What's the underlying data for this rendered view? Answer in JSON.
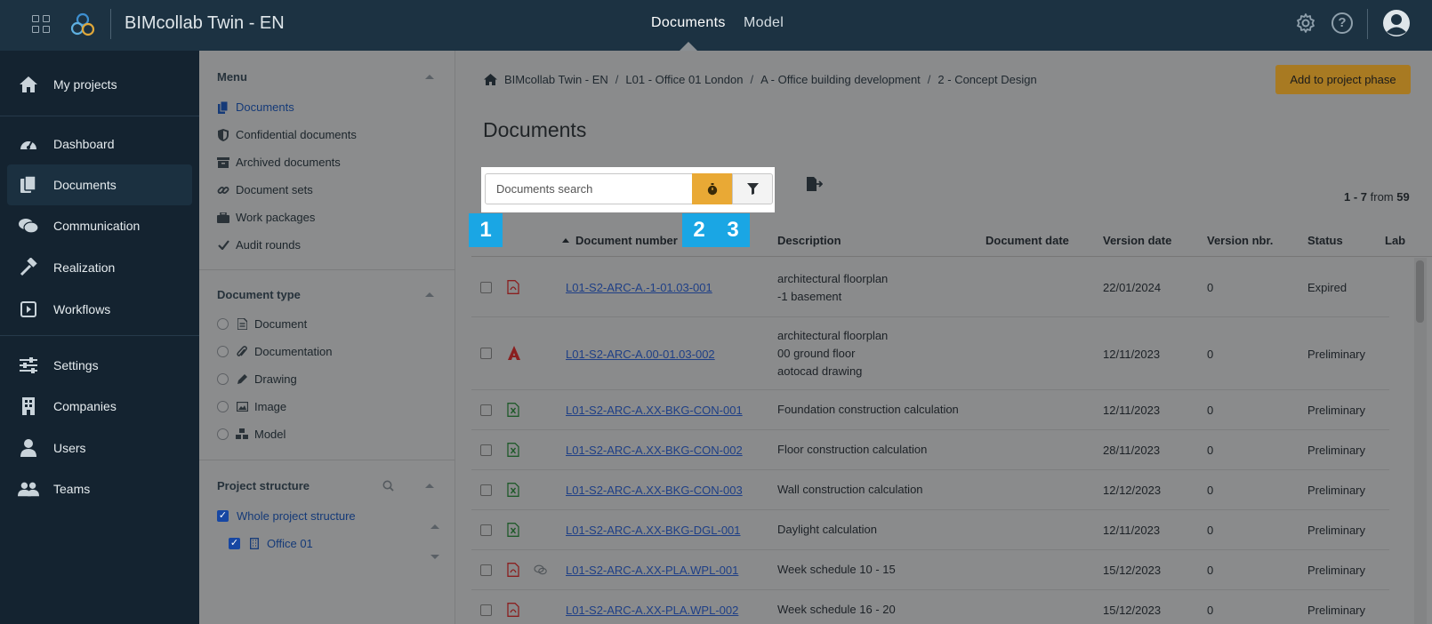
{
  "topbar": {
    "app_title": "BIMcollab Twin - EN",
    "nav_documents": "Documents",
    "nav_model": "Model"
  },
  "sidebar": {
    "items": [
      {
        "label": "My projects",
        "icon": "home-icon"
      },
      {
        "label": "Dashboard",
        "icon": "gauge-icon"
      },
      {
        "label": "Documents",
        "icon": "documents-icon",
        "active": true
      },
      {
        "label": "Communication",
        "icon": "chat-icon"
      },
      {
        "label": "Realization",
        "icon": "hammer-icon"
      },
      {
        "label": "Workflows",
        "icon": "workflow-icon"
      },
      {
        "label": "Settings",
        "icon": "sliders-icon"
      },
      {
        "label": "Companies",
        "icon": "building-icon"
      },
      {
        "label": "Users",
        "icon": "user-icon"
      },
      {
        "label": "Teams",
        "icon": "team-icon"
      }
    ]
  },
  "filters": {
    "menu_heading": "Menu",
    "menu_items": [
      {
        "label": "Documents",
        "icon": "documents-icon"
      },
      {
        "label": "Confidential documents",
        "icon": "shield-icon"
      },
      {
        "label": "Archived documents",
        "icon": "archive-icon"
      },
      {
        "label": "Document sets",
        "icon": "link-icon"
      },
      {
        "label": "Work packages",
        "icon": "briefcase-icon"
      },
      {
        "label": "Audit rounds",
        "icon": "check-icon"
      }
    ],
    "doctype_heading": "Document type",
    "doctype_items": [
      {
        "label": "Document",
        "icon": "file-icon"
      },
      {
        "label": "Documentation",
        "icon": "paperclip-icon"
      },
      {
        "label": "Drawing",
        "icon": "pencil-icon"
      },
      {
        "label": "Image",
        "icon": "image-icon"
      },
      {
        "label": "Model",
        "icon": "cubes-icon"
      }
    ],
    "structure_heading": "Project structure",
    "structure_items": [
      {
        "label": "Whole project structure",
        "checked": true
      },
      {
        "label": "Office 01",
        "checked": true,
        "icon": "building-icon"
      }
    ]
  },
  "main": {
    "breadcrumb": [
      "BIMcollab Twin - EN",
      "L01 - Office 01 London",
      "A - Office building development",
      "2 - Concept Design"
    ],
    "add_phase_label": "Add to project phase",
    "page_title": "Documents",
    "search_placeholder": "Documents search",
    "badges": [
      "1",
      "2",
      "3"
    ],
    "pager": {
      "range": "1 - 7",
      "from_label": "from",
      "total": "59"
    },
    "columns": [
      "Document number",
      "Description",
      "Document date",
      "Version date",
      "Version nbr.",
      "Status",
      "Lab"
    ],
    "rows": [
      {
        "type": "pdf",
        "number": "L01-S2-ARC-A.-1-01.03-001",
        "desc": [
          "architectural floorplan",
          "-1 basement"
        ],
        "version_date": "22/01/2024",
        "version_nbr": "0",
        "status": "Expired"
      },
      {
        "type": "autocad",
        "number": "L01-S2-ARC-A.00-01.03-002",
        "desc": [
          "architectural floorplan",
          "00 ground floor",
          "aotocad drawing"
        ],
        "version_date": "12/11/2023",
        "version_nbr": "0",
        "status": "Preliminary"
      },
      {
        "type": "excel",
        "number": "L01-S2-ARC-A.XX-BKG-CON-001",
        "desc": [
          "Foundation construction calculation"
        ],
        "version_date": "12/11/2023",
        "version_nbr": "0",
        "status": "Preliminary"
      },
      {
        "type": "excel",
        "number": "L01-S2-ARC-A.XX-BKG-CON-002",
        "desc": [
          "Floor construction calculation"
        ],
        "version_date": "28/11/2023",
        "version_nbr": "0",
        "status": "Preliminary"
      },
      {
        "type": "excel",
        "number": "L01-S2-ARC-A.XX-BKG-CON-003",
        "desc": [
          "Wall construction calculation"
        ],
        "version_date": "12/12/2023",
        "version_nbr": "0",
        "status": "Preliminary"
      },
      {
        "type": "excel",
        "number": "L01-S2-ARC-A.XX-BKG-DGL-001",
        "desc": [
          "Daylight calculation"
        ],
        "version_date": "12/11/2023",
        "version_nbr": "0",
        "status": "Preliminary"
      },
      {
        "type": "pdf",
        "comment": true,
        "number": "L01-S2-ARC-A.XX-PLA.WPL-001",
        "desc": [
          "Week schedule 10 - 15"
        ],
        "version_date": "15/12/2023",
        "version_nbr": "0",
        "status": "Preliminary"
      },
      {
        "type": "pdf",
        "number": "L01-S2-ARC-A.XX-PLA.WPL-002",
        "desc": [
          "Week schedule 16 - 20"
        ],
        "version_date": "15/12/2023",
        "version_nbr": "0",
        "status": "Preliminary"
      }
    ]
  },
  "colors": {
    "topbar": "#1c3242",
    "sidebar": "#142330",
    "accent": "#e9a935",
    "badge": "#1aa6e4",
    "link": "#1e3f86"
  }
}
